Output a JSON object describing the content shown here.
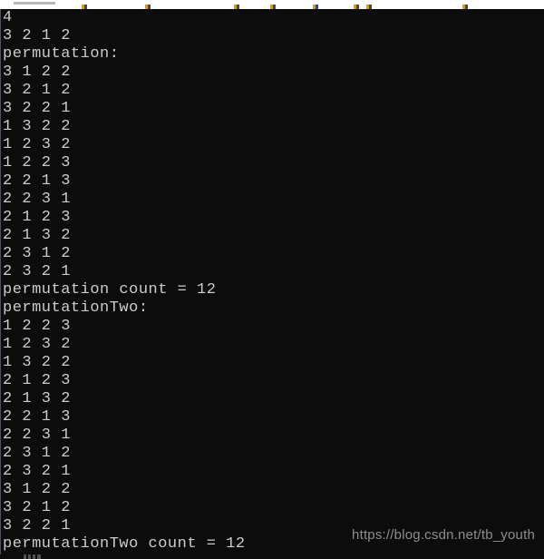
{
  "window": {
    "top_bar_visible": true,
    "background_color": "#0c0c0c",
    "text_color": "#cccccc"
  },
  "console": {
    "lines": [
      "4",
      "3 2 1 2",
      "permutation:",
      "3 1 2 2",
      "3 2 1 2",
      "3 2 2 1",
      "1 3 2 2",
      "1 2 3 2",
      "1 2 2 3",
      "2 2 1 3",
      "2 2 3 1",
      "2 1 2 3",
      "2 1 3 2",
      "2 3 1 2",
      "2 3 2 1",
      "permutation count = 12",
      "permutationTwo:",
      "1 2 2 3",
      "1 2 3 2",
      "1 3 2 2",
      "2 1 2 3",
      "2 1 3 2",
      "2 2 1 3",
      "2 2 3 1",
      "2 3 1 2",
      "2 3 2 1",
      "3 1 2 2",
      "3 2 1 2",
      "3 2 2 1",
      "permutationTwo count = 12"
    ],
    "input": {
      "n": "4",
      "array": "3 2 1 2"
    },
    "sections": [
      {
        "header": "permutation:",
        "rows": [
          "3 1 2 2",
          "3 2 1 2",
          "3 2 2 1",
          "1 3 2 2",
          "1 2 3 2",
          "1 2 2 3",
          "2 2 1 3",
          "2 2 3 1",
          "2 1 2 3",
          "2 1 3 2",
          "2 3 1 2",
          "2 3 2 1"
        ],
        "count_label": "permutation count = 12",
        "count": 12
      },
      {
        "header": "permutationTwo:",
        "rows": [
          "1 2 2 3",
          "1 2 3 2",
          "1 3 2 2",
          "2 1 2 3",
          "2 1 3 2",
          "2 2 1 3",
          "2 2 3 1",
          "2 3 1 2",
          "2 3 2 1",
          "3 1 2 2",
          "3 2 1 2",
          "3 2 2 1"
        ],
        "count_label": "permutationTwo count = 12",
        "count": 12
      }
    ]
  },
  "watermark": {
    "text": "https://blog.csdn.net/tb_youth",
    "color": "#8d8d8d"
  }
}
